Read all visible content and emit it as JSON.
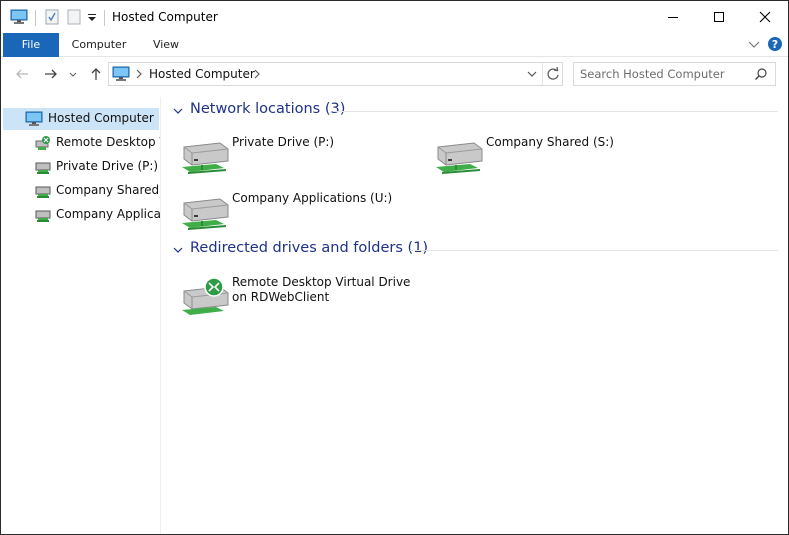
{
  "window": {
    "title": "Hosted Computer"
  },
  "ribbon": {
    "tabs": [
      {
        "label": "File"
      },
      {
        "label": "Computer"
      },
      {
        "label": "View"
      }
    ]
  },
  "address": {
    "path": "Hosted Computer"
  },
  "search": {
    "placeholder": "Search Hosted Computer"
  },
  "nav_pane": {
    "items": [
      {
        "label": "Hosted Computer",
        "icon": "monitor-icon",
        "selected": true
      },
      {
        "label": "Remote Desktop Virtual Drive on RDWebClient",
        "icon": "redirected-drive-icon"
      },
      {
        "label": "Private Drive (P:)",
        "icon": "network-drive-icon"
      },
      {
        "label": "Company Shared (S:)",
        "icon": "network-drive-icon"
      },
      {
        "label": "Company Applications (U:)",
        "icon": "network-drive-icon"
      }
    ]
  },
  "content": {
    "groups": [
      {
        "title": "Network locations (3)",
        "items": [
          {
            "label": "Private Drive (P:)",
            "icon": "network-drive-icon"
          },
          {
            "label": "Company Shared (S:)",
            "icon": "network-drive-icon"
          },
          {
            "label": "Company Applications (U:)",
            "icon": "network-drive-icon"
          }
        ]
      },
      {
        "title": "Redirected drives and folders (1)",
        "items": [
          {
            "label": "Remote Desktop Virtual Drive on RDWebClient",
            "icon": "redirected-drive-icon"
          }
        ]
      }
    ]
  },
  "colors": {
    "accent": "#1a66b8",
    "group_title": "#1e3287",
    "selection": "#cce4f7"
  }
}
